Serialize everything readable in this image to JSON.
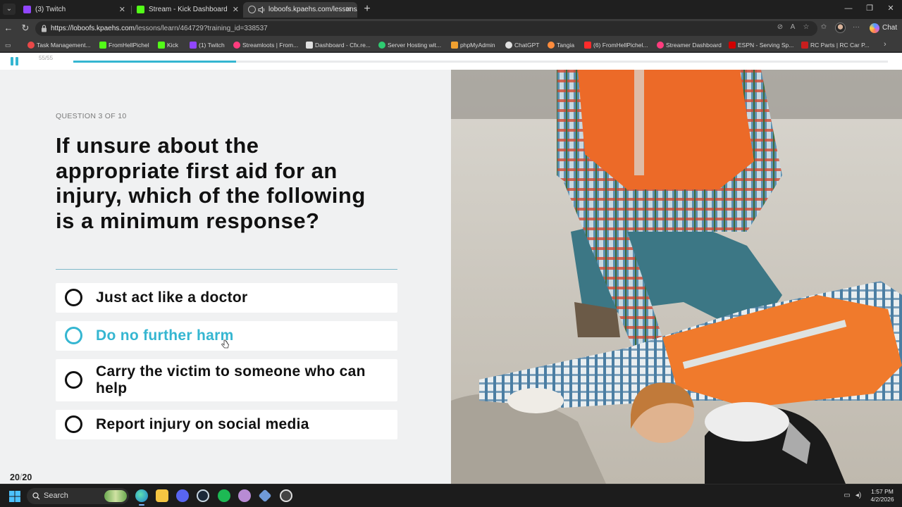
{
  "browser": {
    "tabs": [
      {
        "label": "(3) Twitch",
        "favicon_color": "#9146ff"
      },
      {
        "label": "Stream - Kick Dashboard",
        "favicon_color": "#53fc18"
      },
      {
        "label": "loboofs.kpaehs.com/lessons/l",
        "favicon_color": "#9aa0a6"
      }
    ],
    "url_domain": "https://loboofs.kpaehs.com",
    "url_path": "/lessons/learn/464729?training_id=338537",
    "chat_label": "Chat",
    "bookmarks": [
      {
        "label": "Task Management...",
        "color": "#e94848"
      },
      {
        "label": "FromHellPichel",
        "color": "#53fc18"
      },
      {
        "label": "Kick",
        "color": "#53fc18"
      },
      {
        "label": "(1) Twitch",
        "color": "#9146ff"
      },
      {
        "label": "Streamloots | From...",
        "color": "#ff3c7e"
      },
      {
        "label": "Dashboard - Cfx.re...",
        "color": "#e0e0e0"
      },
      {
        "label": "Server Hosting wit...",
        "color": "#2ecc71"
      },
      {
        "label": "phpMyAdmin",
        "color": "#f0a030"
      },
      {
        "label": "ChatGPT",
        "color": "#e0e0e0"
      },
      {
        "label": "Tangia",
        "color": "#ff8c3c"
      },
      {
        "label": "(6) FromHellPichel...",
        "color": "#ff2b2b"
      },
      {
        "label": "Streamer Dashboard",
        "color": "#ff3c7e"
      },
      {
        "label": "ESPN - Serving Sp...",
        "color": "#d00000"
      },
      {
        "label": "RC Parts | RC Car P...",
        "color": "#c81e1e"
      }
    ]
  },
  "lesson": {
    "slide_counter": "55/55",
    "progress": 0.2,
    "accent_color": "#35b6d1",
    "question_label": "QUESTION 3 OF 10",
    "question_text": "If unsure about the appropriate first aid for an injury, which of the following is a minimum response?",
    "options": [
      {
        "label": "Just act like a doctor",
        "hovered": false
      },
      {
        "label": "Do no further harm",
        "hovered": true
      },
      {
        "label": "Carry the victim to someone who can help",
        "hovered": false
      },
      {
        "label": "Report injury on social media",
        "hovered": false
      }
    ],
    "logo": {
      "main": "20",
      "sub": "20"
    },
    "image_subject": "Worker in orange safety vest kneeling to help an injured coworker lying on the ground"
  },
  "taskbar": {
    "search_placeholder": "Search",
    "time": "1:57 PM",
    "date": "4/2/2026"
  }
}
